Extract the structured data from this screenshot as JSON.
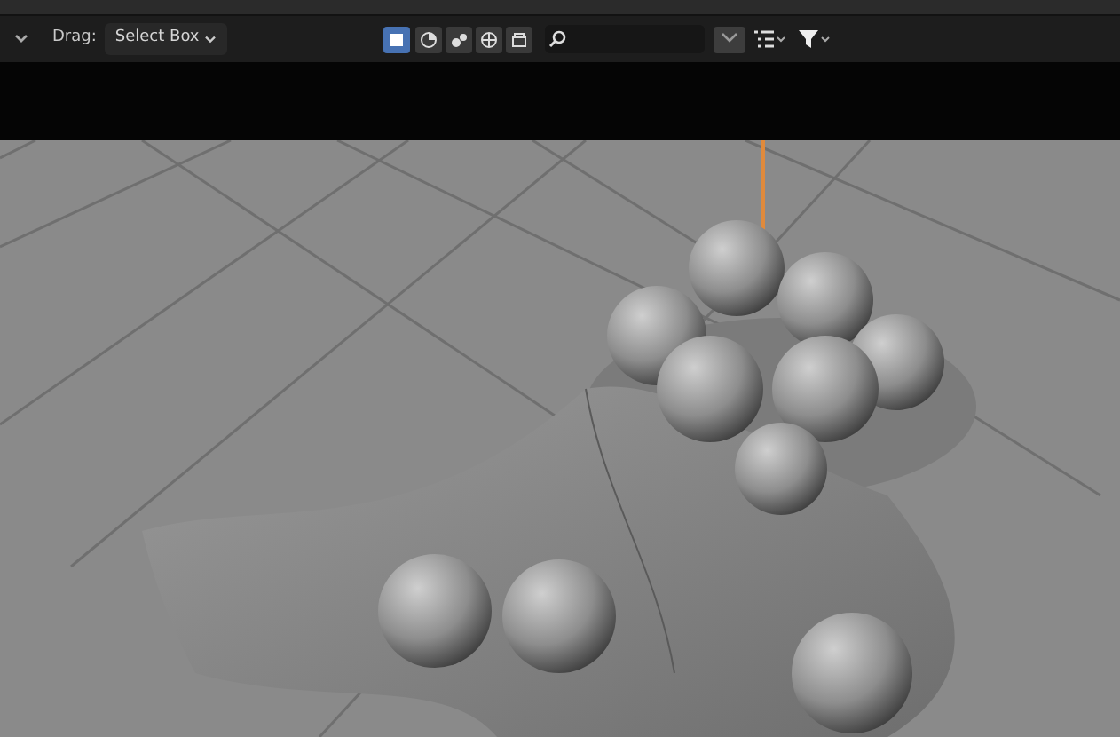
{
  "toolbar": {
    "drag_label": "Drag:",
    "drag_value": "Select Box"
  },
  "select_modes": [
    {
      "selected": true
    },
    {
      "selected": false
    },
    {
      "selected": false
    },
    {
      "selected": false
    },
    {
      "selected": false
    }
  ]
}
